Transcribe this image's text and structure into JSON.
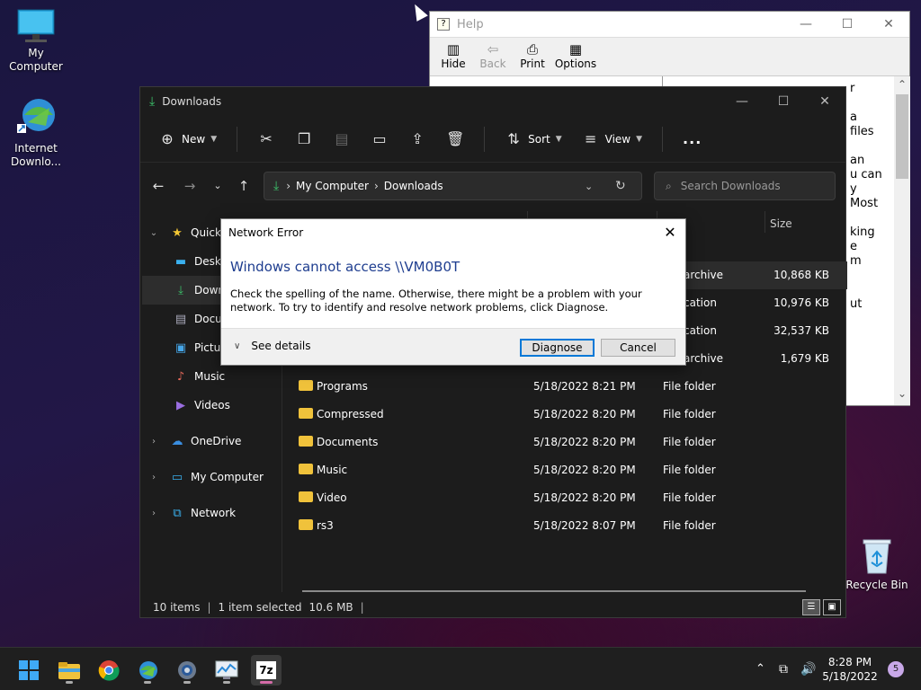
{
  "desktop": {
    "icons": [
      {
        "label": "My Computer"
      },
      {
        "label": "Internet Downlo..."
      },
      {
        "label": "Recycle Bin"
      }
    ]
  },
  "help_window": {
    "title": "Help",
    "toolbar": [
      {
        "label": "Hide",
        "icon": "hide-icon",
        "enabled": true
      },
      {
        "label": "Back",
        "icon": "back-arrow-icon",
        "enabled": false
      },
      {
        "label": "Print",
        "icon": "printer-icon",
        "enabled": true
      },
      {
        "label": "Options",
        "icon": "options-icon",
        "enabled": true
      }
    ],
    "content_text": "r\n\na\nfiles\n\nan\nu can\ny\nMost\n\nking\ne\nm\n\n\nut"
  },
  "explorer": {
    "title": "Downloads",
    "toolbar": {
      "new_label": "New",
      "sort_label": "Sort",
      "view_label": "View",
      "more_label": "..."
    },
    "address": {
      "segments": [
        "My Computer",
        "Downloads"
      ]
    },
    "search_placeholder": "Search Downloads",
    "sidebar": [
      {
        "label": "Quick access",
        "icon": "star-icon",
        "chevron": "open"
      },
      {
        "label": "Desktop",
        "icon": "desktop-icon"
      },
      {
        "label": "Downloads",
        "icon": "download-icon"
      },
      {
        "label": "Documents",
        "icon": "document-icon"
      },
      {
        "label": "Pictures",
        "icon": "picture-icon"
      },
      {
        "label": "Music",
        "icon": "music-icon"
      },
      {
        "label": "Videos",
        "icon": "video-icon"
      },
      {
        "label": "OneDrive",
        "icon": "cloud-icon",
        "chevron": "closed"
      },
      {
        "label": "My Computer",
        "icon": "computer-icon",
        "chevron": "closed"
      },
      {
        "label": "Network",
        "icon": "network-icon",
        "chevron": "closed"
      }
    ],
    "columns": {
      "size": "Size"
    },
    "files": [
      {
        "name": "",
        "date": "",
        "type": "archive",
        "size": "10,868 KB",
        "selected": true
      },
      {
        "name": "",
        "date": "",
        "type": "cation",
        "size": "10,976 KB"
      },
      {
        "name": "",
        "date": "",
        "type": "cation",
        "size": "32,537 KB"
      },
      {
        "name": "",
        "date": "",
        "type": "archive",
        "size": "1,679 KB"
      },
      {
        "name": "Programs",
        "date": "5/18/2022 8:21 PM",
        "type": "File folder",
        "size": ""
      },
      {
        "name": "Compressed",
        "date": "5/18/2022 8:20 PM",
        "type": "File folder",
        "size": ""
      },
      {
        "name": "Documents",
        "date": "5/18/2022 8:20 PM",
        "type": "File folder",
        "size": ""
      },
      {
        "name": "Music",
        "date": "5/18/2022 8:20 PM",
        "type": "File folder",
        "size": ""
      },
      {
        "name": "Video",
        "date": "5/18/2022 8:20 PM",
        "type": "File folder",
        "size": ""
      },
      {
        "name": "rs3",
        "date": "5/18/2022 8:07 PM",
        "type": "File folder",
        "size": ""
      }
    ],
    "status": {
      "items": "10 items",
      "selected": "1 item selected",
      "size": "10.6 MB"
    }
  },
  "dialog": {
    "title": "Network Error",
    "heading": "Windows cannot access \\\\VM0B0T",
    "body": "Check the spelling of the name. Otherwise, there might be a problem with your network. To try to identify and resolve network problems, click Diagnose.",
    "details_label": "See details",
    "diagnose_label": "Diagnose",
    "cancel_label": "Cancel"
  },
  "taskbar": {
    "apps": [
      "start-icon",
      "file-explorer-icon",
      "chrome-icon",
      "internet-download-manager-icon",
      "settings-icon",
      "resource-monitor-icon",
      "7zip-icon"
    ],
    "time": "8:28 PM",
    "date": "5/18/2022",
    "notification_count": "5",
    "colors": {
      "accent": "#0078d7",
      "folder": "#f0c23b"
    }
  }
}
